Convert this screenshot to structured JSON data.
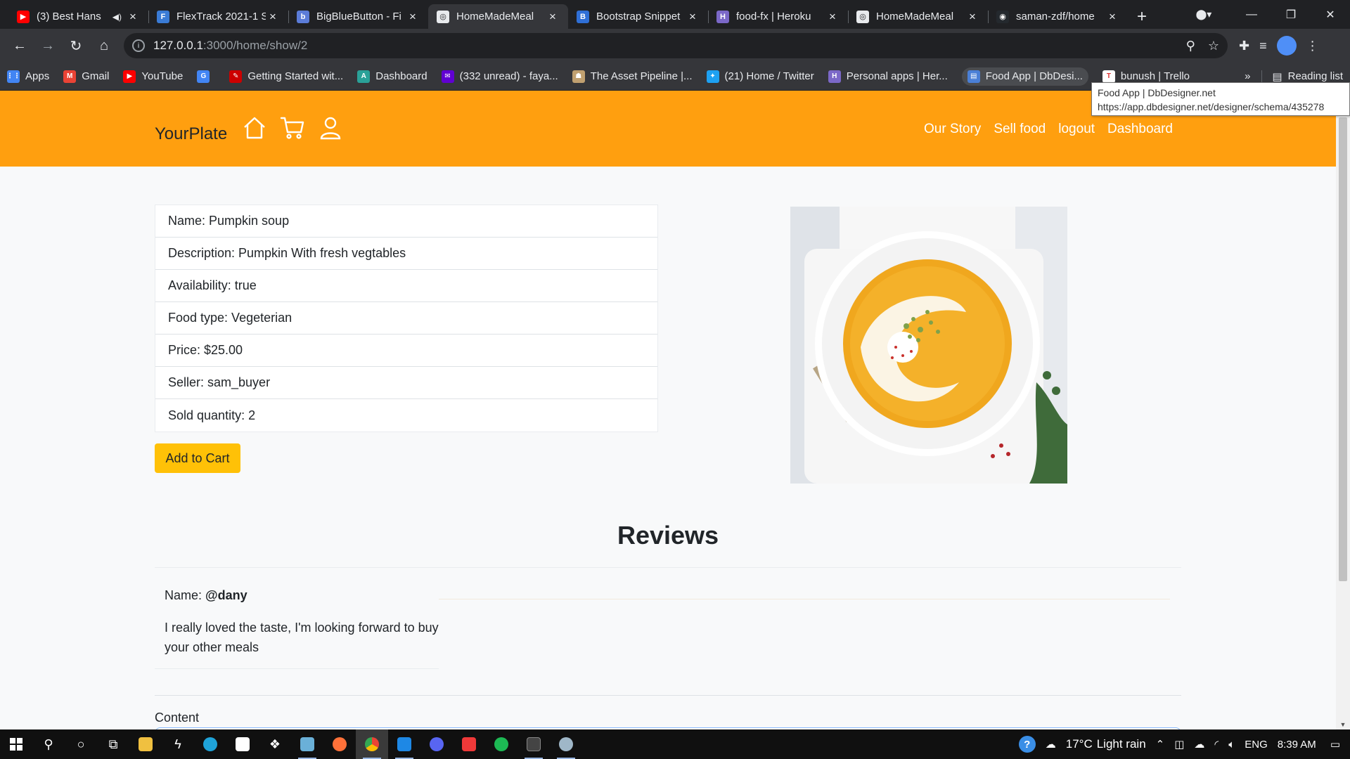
{
  "browser": {
    "tabs": [
      {
        "title": "(3) Best Hans",
        "fav": "#ff0000",
        "glyph": "▶",
        "audio": true,
        "active": false
      },
      {
        "title": "FlexTrack 2021-1 S",
        "fav": "#3a7bd5",
        "glyph": "F",
        "audio": false,
        "active": false
      },
      {
        "title": "BigBlueButton - Fi",
        "fav": "#5b7cd8",
        "glyph": "b",
        "audio": false,
        "active": false
      },
      {
        "title": "HomeMadeMeal",
        "fav": "#e8eaed",
        "glyph": "◎",
        "audio": false,
        "active": true
      },
      {
        "title": "Bootstrap Snippet",
        "fav": "#2f6fd6",
        "glyph": "B",
        "audio": false,
        "active": false
      },
      {
        "title": "food-fx | Heroku",
        "fav": "#7b68c8",
        "glyph": "H",
        "audio": false,
        "active": false
      },
      {
        "title": "HomeMadeMeal",
        "fav": "#e8eaed",
        "glyph": "◎",
        "audio": false,
        "active": false
      },
      {
        "title": "saman-zdf/home",
        "fav": "#24292e",
        "glyph": "◉",
        "audio": false,
        "active": false
      }
    ],
    "url_host": "127.0.0.1",
    "url_path": ":3000/home/show/2",
    "bookmarks": [
      {
        "label": "Apps",
        "fav": "#4285f4",
        "glyph": "⋮⋮"
      },
      {
        "label": "Gmail",
        "fav": "#ea4335",
        "glyph": "M"
      },
      {
        "label": "YouTube",
        "fav": "#ff0000",
        "glyph": "▶"
      },
      {
        "label": "",
        "fav": "#4285f4",
        "glyph": "G"
      },
      {
        "label": "Getting Started wit...",
        "fav": "#cc0000",
        "glyph": "✎"
      },
      {
        "label": "Dashboard",
        "fav": "#2aa198",
        "glyph": "A"
      },
      {
        "label": "(332 unread) - faya...",
        "fav": "#6001d2",
        "glyph": "✉"
      },
      {
        "label": "The Asset Pipeline |...",
        "fav": "#c0a070",
        "glyph": "☗"
      },
      {
        "label": "(21) Home / Twitter",
        "fav": "#1da1f2",
        "glyph": "✦"
      },
      {
        "label": "Personal apps | Her...",
        "fav": "#7b68c8",
        "glyph": "H"
      },
      {
        "label": "Food App | DbDesi...",
        "fav": "#4a7fd6",
        "glyph": "▤",
        "highlight": true
      },
      {
        "label": "bunush | Trello",
        "fav": "#ffffff",
        "glyph": "T"
      }
    ],
    "bookmarks_more": "»",
    "reading_list": "Reading list",
    "tooltip_title": "Food App | DbDesigner.net",
    "tooltip_url": "https://app.dbdesigner.net/designer/schema/435278"
  },
  "navbar": {
    "brand": "YourPlate",
    "links": [
      "Our Story",
      "Sell food",
      "logout",
      "Dashboard"
    ]
  },
  "food": {
    "details": [
      "Name: Pumpkin soup",
      "Description: Pumpkin With fresh vegtables",
      "Availability: true",
      "Food type: Vegeterian",
      "Price: $25.00",
      "Seller: sam_buyer",
      "Sold quantity: 2"
    ],
    "add_to_cart": "Add to Cart"
  },
  "reviews": {
    "title": "Reviews",
    "name_label": "Name: ",
    "reviewer": "@dany",
    "text": "I really loved the taste, I'm looking forward to buy your other meals",
    "content_label": "Content"
  },
  "taskbar": {
    "temperature": "17°C",
    "weather": "Light rain",
    "language": "ENG",
    "time": "8:39 AM"
  }
}
